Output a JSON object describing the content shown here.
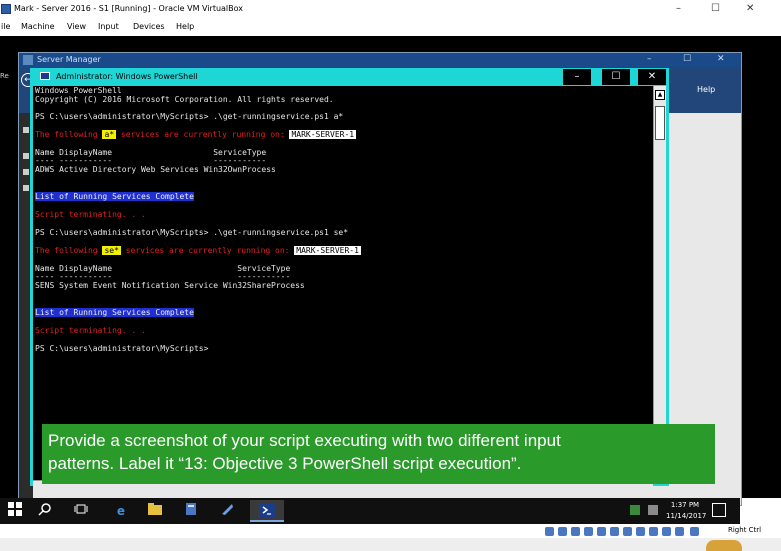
{
  "vbox": {
    "title": "Mark - Server 2016 - S1 [Running] - Oracle VM VirtualBox",
    "minimize": "–",
    "maximize": "☐",
    "close": "✕",
    "menu": [
      "ile",
      "Machine",
      "View",
      "Input",
      "Devices",
      "Help"
    ],
    "status_host_key": "Right Ctrl"
  },
  "server_manager": {
    "title": "Server Manager",
    "help_label": "Help",
    "back_glyph": "←",
    "minimize": "–",
    "maximize": "☐",
    "close": "✕",
    "edge_label": "Re"
  },
  "powershell": {
    "title": "Administrator: Windows PowerShell",
    "minimize": "–",
    "maximize": "☐",
    "close": "✕",
    "lines": {
      "l1": "Windows PowerShell",
      "l2": "Copyright (C) 2016 Microsoft Corporation. All rights reserved.",
      "l3": "PS C:\\users\\administrator\\MyScripts> .\\get-runningservice.ps1 a*",
      "l4_pre": "The following ",
      "l4_hl": "a*",
      "l4_mid": " services are currently running on: ",
      "l4_host": "MARK-SERVER-1",
      "l5": "Name DisplayName                     ServiceType",
      "l6": "---- -----------                     -----------",
      "l7": "ADWS Active Directory Web Services Win32OwnProcess",
      "l8": "List of Running Services Complete",
      "l9": "Script terminating. . .",
      "l10": "PS C:\\users\\administrator\\MyScripts> .\\get-runningservice.ps1 se*",
      "l11_pre": "The following ",
      "l11_hl": "se*",
      "l11_mid": " services are currently running on: ",
      "l11_host": "MARK-SERVER-1",
      "l12": "Name DisplayName                          ServiceType",
      "l13": "---- -----------                          -----------",
      "l14": "SENS System Event Notification Service Win32ShareProcess",
      "l15": "List of Running Services Complete",
      "l16": "Script terminating. . .",
      "l17": "PS C:\\users\\administrator\\MyScripts>"
    }
  },
  "annotation": {
    "line1": "Provide a screenshot of your script executing with two different input",
    "line2": "patterns.  Label it “13: Objective 3 PowerShell script execution”."
  },
  "taskbar": {
    "clock_time": "1:37 PM",
    "clock_date": "11/14/2017"
  },
  "colors": {
    "ps_frame": "#1fd6d6",
    "console_bg": "#000000",
    "error_red": "#e02020",
    "highlight_yellow": "#f0f000",
    "highlight_blue": "#1f2fd0",
    "note_green": "#2a9a2a"
  },
  "icons": {
    "start": "windows-start-icon",
    "search": "search-icon",
    "task_view": "task-view-icon",
    "edge": "edge-browser-icon",
    "explorer": "file-explorer-icon",
    "server_manager": "server-manager-icon",
    "tool": "tool-icon",
    "powershell": "powershell-icon",
    "notification": "notification-icon"
  }
}
